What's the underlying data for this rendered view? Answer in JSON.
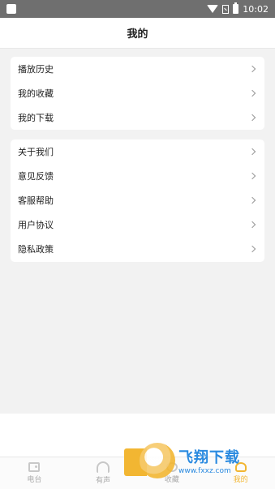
{
  "status_bar": {
    "time": "10:02"
  },
  "header": {
    "title": "我的"
  },
  "section1": {
    "items": [
      {
        "label": "播放历史"
      },
      {
        "label": "我的收藏"
      },
      {
        "label": "我的下载"
      }
    ]
  },
  "section2": {
    "items": [
      {
        "label": "关于我们"
      },
      {
        "label": "意见反馈"
      },
      {
        "label": "客服帮助"
      },
      {
        "label": "用户协议"
      },
      {
        "label": "隐私政策"
      }
    ]
  },
  "tabbar": {
    "tabs": [
      {
        "label": "电台",
        "icon": "radio-icon"
      },
      {
        "label": "有声",
        "icon": "headphone-icon"
      },
      {
        "label": "收藏",
        "icon": "star-icon"
      },
      {
        "label": "我的",
        "icon": "person-icon",
        "active": true
      }
    ],
    "accent_color": "#f2b632"
  },
  "watermark": {
    "title": "飞翔下载",
    "url": "www.fxxz.com"
  }
}
